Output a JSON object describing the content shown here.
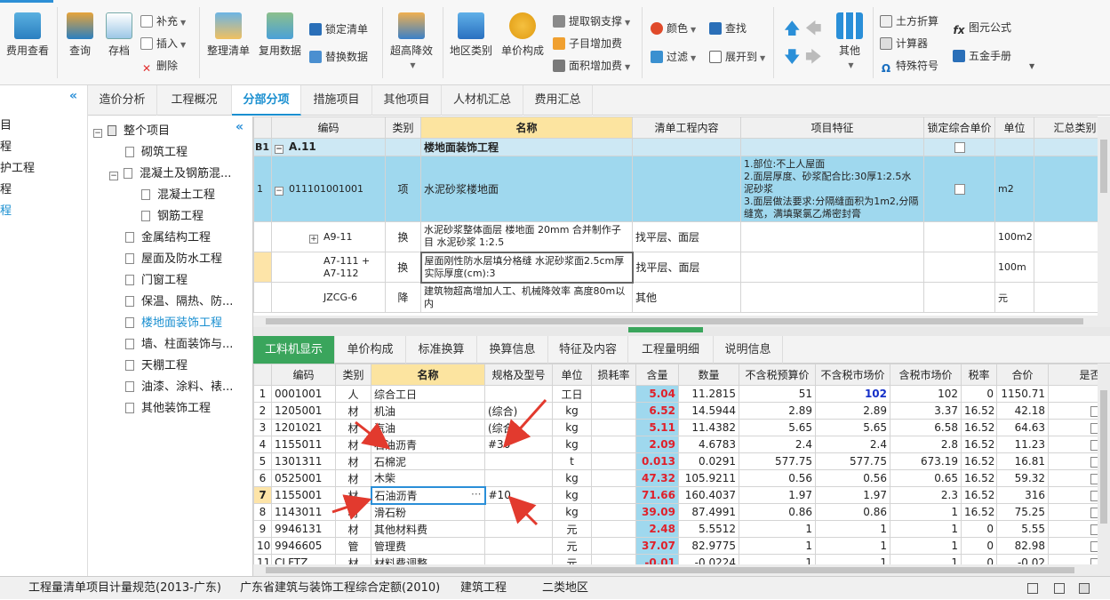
{
  "ribbon": {
    "fee_view": "费用查看",
    "query": "查询",
    "save": "存档",
    "supplement": "补充",
    "insert": "插入",
    "delete": "删除",
    "organize": "整理清单",
    "reuse": "复用数据",
    "lock_list": "锁定清单",
    "replace_data": "替换数据",
    "high_rise": "超高降效",
    "region_cat": "地区类别",
    "unit_price": "单价构成",
    "extract_rebar": "提取钢支撑",
    "child_add_fee": "子目增加费",
    "area_add_fee": "面积增加费",
    "color": "颜色",
    "find": "查找",
    "filter": "过滤",
    "expand_to": "展开到",
    "other": "其他",
    "earth_convert": "土方折算",
    "calculator": "计算器",
    "special_symbol": "特殊符号",
    "formula": "图元公式",
    "handbook": "五金手册"
  },
  "leftnav": [
    "目",
    "程",
    "护工程",
    "程",
    "程"
  ],
  "top_tabs": [
    "造价分析",
    "工程概况",
    "分部分项",
    "措施项目",
    "其他项目",
    "人材机汇总",
    "费用汇总"
  ],
  "tree": {
    "root": "整个项目",
    "items": [
      "砌筑工程",
      "混凝土及钢筋混...",
      "混凝土工程",
      "钢筋工程",
      "金属结构工程",
      "屋面及防水工程",
      "门窗工程",
      "保温、隔热、防...",
      "楼地面装饰工程",
      "墙、柱面装饰与...",
      "天棚工程",
      "油漆、涂料、裱...",
      "其他装饰工程"
    ]
  },
  "grid1": {
    "headers": [
      "编码",
      "类别",
      "名称",
      "清单工程内容",
      "项目特征",
      "锁定综合单价",
      "单位",
      "汇总类别"
    ],
    "rows": [
      {
        "idx": "B1",
        "code": "A.11",
        "type": "",
        "name": "楼地面装饰工程",
        "content": "",
        "feature": "",
        "unit": ""
      },
      {
        "idx": "1",
        "code": "011101001001",
        "type": "项",
        "name": "水泥砂浆楼地面",
        "content": "",
        "feature": "1.部位:不上人屋面\n2.面层厚度、砂浆配合比:30厚1:2.5水泥砂浆\n3.面层做法要求:分隔缝面积为1m2,分隔缝宽，满填聚氯乙烯密封膏",
        "unit": "m2"
      },
      {
        "idx": "",
        "code": "A9-11",
        "type": "换",
        "name": "水泥砂浆整体面层 楼地面 20mm  合并制作子目 水泥砂浆 1:2.5",
        "content": "找平层、面层",
        "feature": "",
        "unit": "100m2"
      },
      {
        "idx": "",
        "code": "A7-111 + A7-112",
        "type": "换",
        "name": "屋面刚性防水层填分格缝 水泥砂浆面2.5cm厚  实际厚度(cm):3",
        "content": "找平层、面层",
        "feature": "",
        "unit": "100m"
      },
      {
        "idx": "",
        "code": "JZCG-6",
        "type": "降",
        "name": "建筑物超高增加人工、机械降效率 高度80m以内",
        "content": "其他",
        "feature": "",
        "unit": "元"
      }
    ]
  },
  "bottom_tabs": [
    "工料机显示",
    "单价构成",
    "标准换算",
    "换算信息",
    "特征及内容",
    "工程量明细",
    "说明信息"
  ],
  "grid2": {
    "headers": [
      "编码",
      "类别",
      "名称",
      "规格及型号",
      "单位",
      "损耗率",
      "含量",
      "数量",
      "不含税预算价",
      "不含税市场价",
      "含税市场价",
      "税率",
      "合价",
      "是否暂"
    ],
    "rows": [
      {
        "i": "1",
        "code": "0001001",
        "type": "人",
        "name": "综合工日",
        "spec": "",
        "unit": "工日",
        "qty": "5.04",
        "num": "11.2815",
        "p1": "51",
        "p2": "102",
        "p3": "102",
        "tax": "0",
        "total": "1150.71",
        "chk": false
      },
      {
        "i": "2",
        "code": "1205001",
        "type": "材",
        "name": "机油",
        "spec": "(综合)",
        "unit": "kg",
        "qty": "6.52",
        "num": "14.5944",
        "p1": "2.89",
        "p2": "2.89",
        "p3": "3.37",
        "tax": "16.52",
        "total": "42.18",
        "chk": true
      },
      {
        "i": "3",
        "code": "1201021",
        "type": "材",
        "name": "汽油",
        "spec": "(综合",
        "unit": "kg",
        "qty": "5.11",
        "num": "11.4382",
        "p1": "5.65",
        "p2": "5.65",
        "p3": "6.58",
        "tax": "16.52",
        "total": "64.63",
        "chk": true
      },
      {
        "i": "4",
        "code": "1155011",
        "type": "材",
        "name": "石油沥青",
        "spec": "#30",
        "unit": "kg",
        "qty": "2.09",
        "num": "4.6783",
        "p1": "2.4",
        "p2": "2.4",
        "p3": "2.8",
        "tax": "16.52",
        "total": "11.23",
        "chk": true
      },
      {
        "i": "5",
        "code": "1301311",
        "type": "材",
        "name": "石棉泥",
        "spec": "",
        "unit": "t",
        "qty": "0.013",
        "num": "0.0291",
        "p1": "577.75",
        "p2": "577.75",
        "p3": "673.19",
        "tax": "16.52",
        "total": "16.81",
        "chk": true
      },
      {
        "i": "6",
        "code": "0525001",
        "type": "材",
        "name": "木柴",
        "spec": "",
        "unit": "kg",
        "qty": "47.32",
        "num": "105.9211",
        "p1": "0.56",
        "p2": "0.56",
        "p3": "0.65",
        "tax": "16.52",
        "total": "59.32",
        "chk": true
      },
      {
        "i": "7",
        "code": "1155001",
        "type": "材",
        "name": "石油沥青",
        "spec": "#10",
        "unit": "kg",
        "qty": "71.66",
        "num": "160.4037",
        "p1": "1.97",
        "p2": "1.97",
        "p3": "2.3",
        "tax": "16.52",
        "total": "316",
        "chk": true
      },
      {
        "i": "8",
        "code": "1143011",
        "type": "材",
        "name": "滑石粉",
        "spec": "",
        "unit": "kg",
        "qty": "39.09",
        "num": "87.4991",
        "p1": "0.86",
        "p2": "0.86",
        "p3": "1",
        "tax": "16.52",
        "total": "75.25",
        "chk": true
      },
      {
        "i": "9",
        "code": "9946131",
        "type": "材",
        "name": "其他材料费",
        "spec": "",
        "unit": "元",
        "qty": "2.48",
        "num": "5.5512",
        "p1": "1",
        "p2": "1",
        "p3": "1",
        "tax": "0",
        "total": "5.55",
        "chk": true
      },
      {
        "i": "10",
        "code": "9946605",
        "type": "管",
        "name": "管理费",
        "spec": "",
        "unit": "元",
        "qty": "37.07",
        "num": "82.9775",
        "p1": "1",
        "p2": "1",
        "p3": "1",
        "tax": "0",
        "total": "82.98",
        "chk": true
      },
      {
        "i": "11",
        "code": "CLFTZ",
        "type": "材",
        "name": "材料费调整",
        "spec": "",
        "unit": "元",
        "qty": "-0.01",
        "num": "-0.0224",
        "p1": "1",
        "p2": "1",
        "p3": "1",
        "tax": "0",
        "total": "-0.02",
        "chk": true
      }
    ]
  },
  "status": {
    "spec": "工程量清单项目计量规范(2013-广东)",
    "quota": "广东省建筑与装饰工程综合定额(2010)",
    "type": "建筑工程",
    "region": "二类地区"
  },
  "colors": {
    "accent": "#1a8fd0",
    "row_highlight": "#9fd8ee",
    "green_tab": "#3aa55c",
    "red_arrow": "#e23a2e"
  }
}
